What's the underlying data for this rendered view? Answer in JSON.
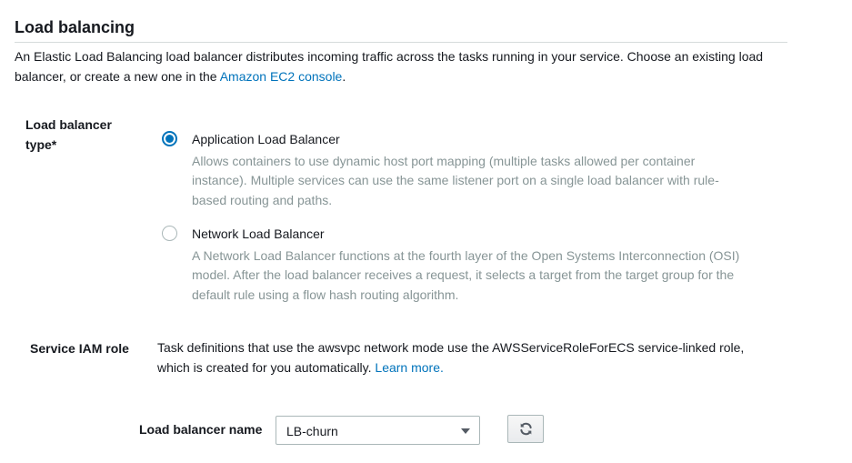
{
  "section": {
    "title": "Load balancing",
    "description_prefix": "An Elastic Load Balancing load balancer distributes incoming traffic across the tasks running in your service. Choose an existing load balancer, or create a new one in the ",
    "description_link": "Amazon EC2 console",
    "description_suffix": "."
  },
  "lb_type": {
    "label": "Load balancer type*",
    "options": [
      {
        "title": "Application Load Balancer",
        "description": "Allows containers to use dynamic host port mapping (multiple tasks allowed per container instance). Multiple services can use the same listener port on a single load balancer with rule-based routing and paths.",
        "selected": true
      },
      {
        "title": "Network Load Balancer",
        "description": "A Network Load Balancer functions at the fourth layer of the Open Systems Interconnection (OSI) model. After the load balancer receives a request, it selects a target from the target group for the default rule using a flow hash routing algorithm.",
        "selected": false
      }
    ]
  },
  "iam": {
    "label": "Service IAM role",
    "text": "Task definitions that use the awsvpc network mode use the AWSServiceRoleForECS service-linked role, which is created for you automatically. ",
    "link": "Learn more."
  },
  "lb_name": {
    "label": "Load balancer name",
    "selected_value": "LB-churn"
  },
  "icons": {
    "caret": "caret-down-icon",
    "refresh": "refresh-icon"
  },
  "colors": {
    "link": "#0073bb",
    "radio_selected": "#0073bb",
    "muted_text": "#879596"
  }
}
